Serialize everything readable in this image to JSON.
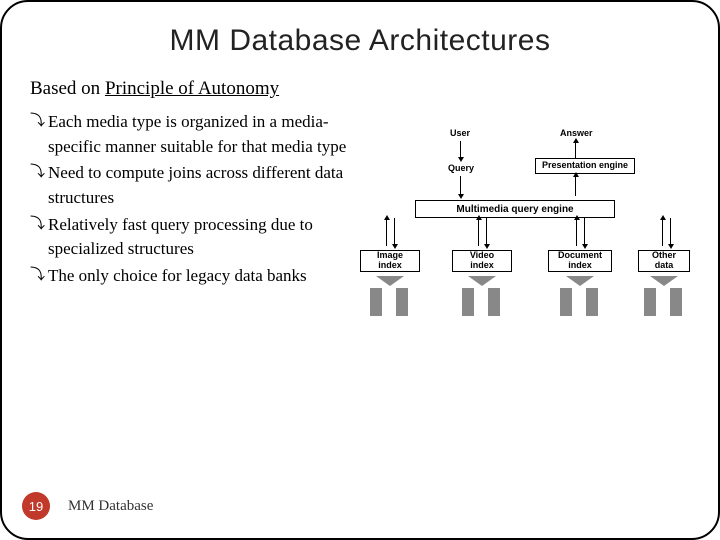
{
  "title": "MM Database Architectures",
  "subtitle_prefix": "Based on ",
  "subtitle_underlined": "Principle of Autonomy",
  "bullets": [
    "Each media type is organized in a media-specific manner suitable for that media type",
    "Need to compute joins across different data structures",
    "Relatively fast query processing due to specialized structures",
    "The only choice for legacy data banks"
  ],
  "diagram": {
    "user": "User",
    "answer": "Answer",
    "query": "Query",
    "presentation": "Presentation engine",
    "mm_engine": "Multimedia query engine",
    "indexes": [
      "Image index",
      "Video index",
      "Document index",
      "Other data"
    ]
  },
  "footer": {
    "page": "19",
    "label": "MM Database"
  }
}
